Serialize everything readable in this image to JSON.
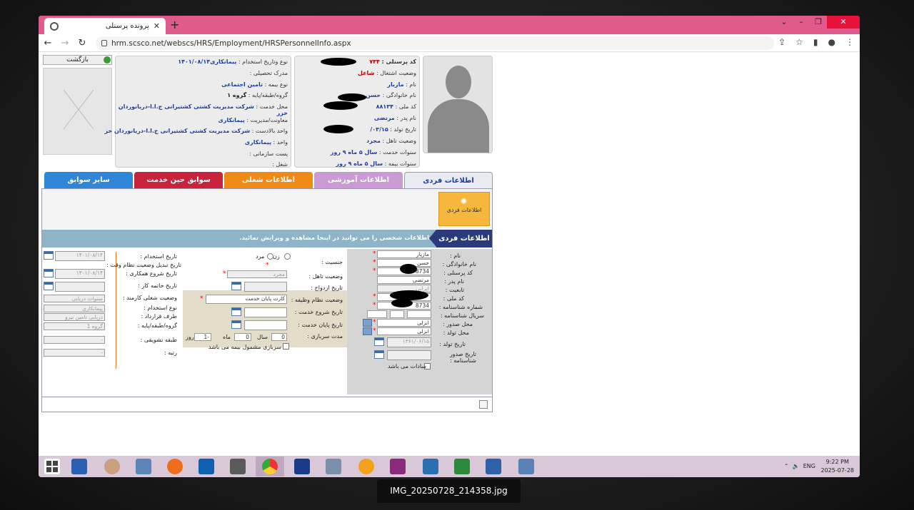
{
  "browser": {
    "tab_title": "پرونده پرسنلی",
    "new_tab": "+",
    "url": "hrm.scsco.net/webscs/HRS/Employment/HRSPersonnelInfo.aspx",
    "icons": [
      "back-icon",
      "forward-icon",
      "reload-icon",
      "lock-icon",
      "share-icon",
      "star-icon",
      "sidepanel-icon",
      "profile-icon",
      "menu-icon"
    ]
  },
  "header": {
    "back_label": "بازگشت",
    "code_label": "کد پرسنلی :",
    "code_value": "۷۳۴",
    "status_label": "وضعیت اشتغال :",
    "status_value": "شاغل",
    "name_label": "نام :",
    "name_value": "مازیار",
    "family_label": "نام خانوادگی :",
    "family_value": "حسن",
    "nid_label": "کد ملی :",
    "nid_value": "۸۸۱۳۴",
    "father_label": "نام پدر :",
    "father_value": "مرتضی",
    "birth_label": "تاریخ تولد :",
    "birth_value": "۰۳/۱۵/",
    "marital_label": "وضعیت تاهل :",
    "marital_value": "مجرد",
    "service_label": "سنوات خدمت :",
    "service_value": "سال ۵ ماه ۹ روز",
    "insurance_label": "سنوات بیمه :",
    "insurance_value": "سال ۵ ماه ۹ روز"
  },
  "employment": {
    "type_label": "نوع وتاریخ استخدام :",
    "type_value": "پیمانکاری۱۴۰۱/۰۸/۱۴",
    "degree_label": "مدرک تحصیلی :",
    "ins_type_label": "نوع بیمه :",
    "ins_type_value": "تامین اجتماعی",
    "group_label": "گروه/طبقه/پایه :",
    "group_value": "گروه ۱",
    "place_label": "محل خدمت :",
    "place_value": "شرکت مدیریت کشتی کشتیرانی ج.ا.ا-دریانوردان خزر",
    "deputy_label": "معاونت/مدیریت :",
    "deputy_value": "پیمانکاری",
    "unit_label": "واحد بالادست :",
    "unit_value": "شرکت مدیریت کشتی کشتیرانی ج.ا.ا-دریانوردان خز",
    "dept_label": "واحد :",
    "dept_value": "پیمانکاری",
    "post_label": "پست سازمانی :",
    "job_label": "شغل :"
  },
  "tabs": [
    {
      "label": "اطلاعات فردی",
      "color": "#eaeaf2",
      "text": "#1b3ea0"
    },
    {
      "label": "اطلاعات آموزشی",
      "color": "#c99ad3",
      "text": "#fff"
    },
    {
      "label": "اطلاعات شغلی",
      "color": "#f08a16",
      "text": "#fff"
    },
    {
      "label": "سوابق حین خدمت",
      "color": "#c8233c",
      "text": "#fff"
    },
    {
      "label": "سایر سوابق",
      "color": "#2f86d8",
      "text": "#fff"
    }
  ],
  "sub_button": "اطلاعات فردی",
  "info_bar": {
    "title": "اطلاعات فردی",
    "text": "اطلاعات شخصی را می توانید در اینجا مشاهده و ویرایش نمائید."
  },
  "form_right": {
    "labels": [
      "نام :",
      "نام خانوادگی :",
      "کد پرسنلی :",
      "نام پدر :",
      "تابعیت :",
      "کد ملی :",
      "شماره شناسنامه :",
      "سریال شناسنامه :",
      "محل صدور :",
      "محل تولد :",
      "تاریخ تولد :",
      "تاریخ صدور شناسنامه :"
    ],
    "values": [
      "مازیار",
      "حسن",
      "8734",
      "مرتضی",
      "ایرانی",
      "",
      "8734",
      "",
      "انزلی",
      "انزلی",
      "۱۳۶۱/۰۶/۱۵",
      ""
    ],
    "sadat": "سادات می باشد"
  },
  "form_mid": {
    "gender_label": "جنسیت :",
    "female": "زن",
    "male": "مرد",
    "marital_label": "وضعیت تاهل :",
    "marital_value": "مجرد",
    "marriage_date_label": "تاریخ ازدواج :",
    "duty_label": "وضعیت نظام وظیفه :",
    "duty_value": "کارت پایان خدمت",
    "duty_start_label": "تاریخ شروع خدمت :",
    "duty_end_label": "تاریخ پایان خدمت :",
    "soldier_label": "مدت سربازی :",
    "year_label": "سال",
    "month_label": "ماه",
    "day_label": "روز",
    "year_val": "0",
    "month_val": "0",
    "day_val": "1-",
    "soldier_ins": "سربازی مشمول بیمه می باشد"
  },
  "form_left": {
    "hire_date_label": "تاریخ استخدام :",
    "hire_date": "۱۴۰۱/۰۸/۱۴",
    "convert_label": "تاریخ تبدیل وضعیت نظام وقت :",
    "coop_label": "تاریخ شروع همکاری :",
    "coop_date": "۱۴۰۱/۰۸/۱۴",
    "end_label": "تاریخ خاتمه کار :",
    "job_status_label": "وضعیت شغلی کارمند :",
    "job_status": "سنوات دریایی",
    "hire_type_label": "نوع استخدام :",
    "hire_type": "پیمانکاری",
    "party_label": "طرف قرارداد :",
    "party": "دریایی تامین نیرو",
    "group_label": "گروه/طبقه/پایه :",
    "group": "گروه 1",
    "incentive_label": "طبقه تشویقی :",
    "incentive": "-",
    "rank_label": "رتبه :",
    "rank": "-"
  },
  "taskbar": {
    "icons": [
      "windows-icon",
      "word-icon",
      "app-icon",
      "computer-icon",
      "firefox-icon",
      "outlook-icon",
      "gj-icon",
      "chrome-icon",
      "shield-icon",
      "brush-icon",
      "sun-icon",
      "winrar-icon",
      "keyboard-icon",
      "calculator-icon",
      "scanner-icon",
      "scanner2-icon"
    ],
    "lang": "ENG",
    "time": "9:22 PM",
    "date": "2025-07-28"
  },
  "caption": "IMG_20250728_214358.jpg"
}
